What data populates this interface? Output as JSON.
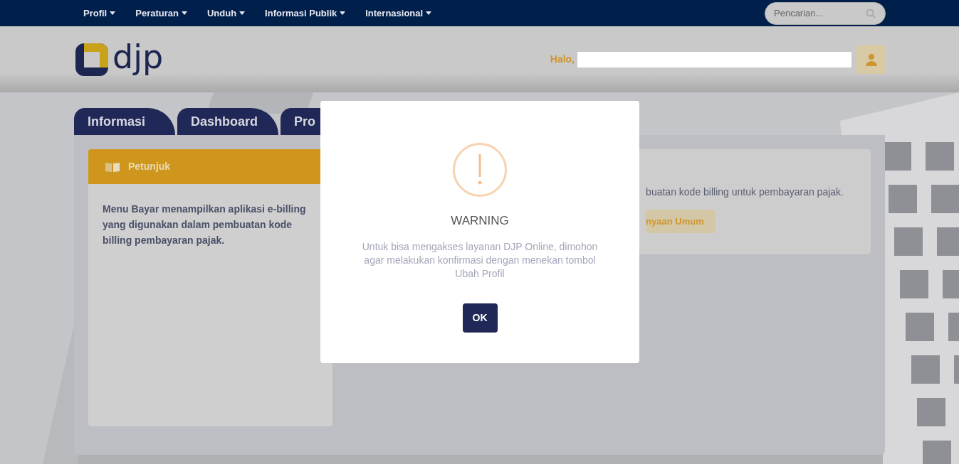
{
  "nav": {
    "items": [
      {
        "label": "Profil"
      },
      {
        "label": "Peraturan"
      },
      {
        "label": "Unduh"
      },
      {
        "label": "Informasi Publik"
      },
      {
        "label": "Internasional"
      }
    ],
    "search": {
      "placeholder": "Pencarian..."
    }
  },
  "header": {
    "logo_text": "djp",
    "greeting": "Halo,"
  },
  "tabs": [
    {
      "label": "Informasi"
    },
    {
      "label": "Dashboard"
    },
    {
      "label": "Pro"
    }
  ],
  "guide": {
    "title": "Petunjuk",
    "text": "Menu Bayar menampilkan aplikasi e-billing yang digunakan dalam pembuatan kode billing pembayaran pajak."
  },
  "info_panel": {
    "text": "buatan kode billing untuk pembayaran pajak.",
    "button": "nyaan Umum"
  },
  "modal": {
    "title": "WARNING",
    "message": "Untuk bisa mengakses layanan DJP Online, dimohon agar melakukan konfirmasi dengan menekan tombol Ubah Profil",
    "button": "OK"
  }
}
